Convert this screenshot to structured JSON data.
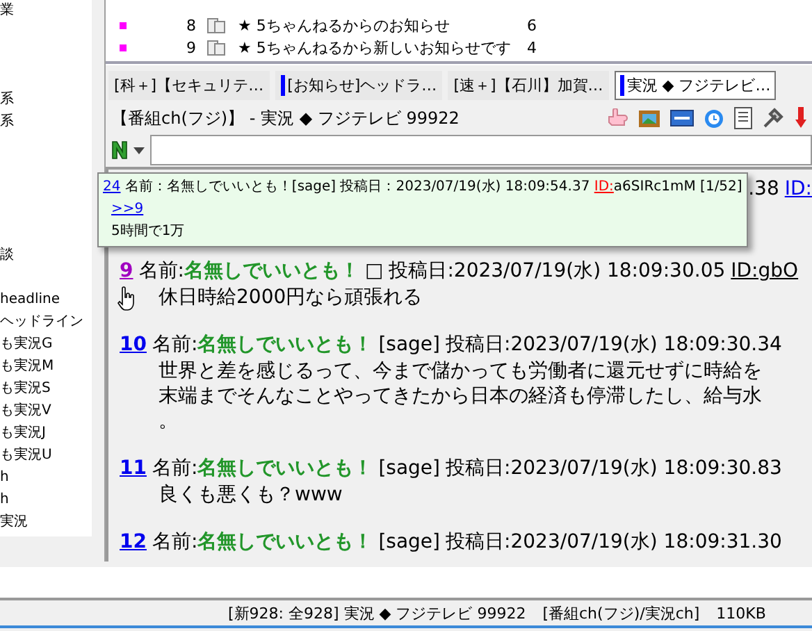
{
  "board_tree": {
    "items": [
      {
        "label": "業"
      },
      {
        "label": "系"
      },
      {
        "label": "系"
      },
      {
        "label": "談"
      },
      {
        "label": "headline"
      },
      {
        "label": "ヘッドライン"
      },
      {
        "label": "も実況G"
      },
      {
        "label": "も実況M"
      },
      {
        "label": "も実況S"
      },
      {
        "label": "も実況V"
      },
      {
        "label": "も実況J"
      },
      {
        "label": "も実況U"
      },
      {
        "label": "h"
      },
      {
        "label": "h"
      },
      {
        "label": "実況"
      }
    ]
  },
  "thread_list": {
    "rows": [
      {
        "number": "8",
        "title": "★ 5ちゃんねるからのお知らせ",
        "count": "6"
      },
      {
        "number": "9",
        "title": "★ 5ちゃんねるから新しいお知らせです",
        "count": "4"
      }
    ]
  },
  "tabs": [
    {
      "label": "[科＋]【セキュリテ…",
      "marked": false,
      "selected": false
    },
    {
      "label": "[お知らせ]ヘッドラ…",
      "marked": true,
      "selected": false
    },
    {
      "label": "[速＋]【石川】加賀…",
      "marked": false,
      "selected": false
    },
    {
      "label": "実況 ◆ フジテレビ…",
      "marked": true,
      "selected": true
    }
  ],
  "thread_title": "【番組ch(フジ)】 - 実況 ◆ フジテレビ 99922",
  "popup": {
    "number": "24",
    "header": "名前：名無しでいいとも！[sage] 投稿日：2023/07/19(水) 18:09:54.37",
    "id_label": "ID:",
    "id_rest": "a6SIRc1mM [1/52]",
    "anchor": ">>9",
    "body": "5時間で1万"
  },
  "hidden_post": {
    "tail": ".38",
    "id_label": "ID:"
  },
  "posts": [
    {
      "number": "9",
      "visited": true,
      "name_label": "名前:",
      "name": "名無しでいいとも！",
      "mail": "□",
      "date": "投稿日:2023/07/19(水) 18:09:30.05",
      "id": "ID:gbO",
      "body": [
        "休日時給2000円なら頑張れる"
      ]
    },
    {
      "number": "10",
      "visited": false,
      "name_label": "名前:",
      "name": "名無しでいいとも！",
      "mail": "[sage]",
      "date": "投稿日:2023/07/19(水) 18:09:30.34",
      "body": [
        "世界と差を感じるって、今まで儲かっても労働者に還元せずに時給を",
        "末端までそんなことやってきたから日本の経済も停滞したし、給与水",
        "。"
      ]
    },
    {
      "number": "11",
      "visited": false,
      "name_label": "名前:",
      "name": "名無しでいいとも！",
      "mail": "[sage]",
      "date": "投稿日:2023/07/19(水) 18:09:30.83",
      "body": [
        "良くも悪くも？www"
      ]
    },
    {
      "number": "12",
      "visited": false,
      "name_label": "名前:",
      "name": "名無しでいいとも！",
      "mail": "[sage]",
      "date": "投稿日:2023/07/19(水) 18:09:31.30"
    }
  ],
  "status_bar": {
    "text": "[新928: 全928] 実況 ◆ フジテレビ 99922",
    "board": "[番組ch(フジ)/実況ch]",
    "size": "110KB"
  }
}
